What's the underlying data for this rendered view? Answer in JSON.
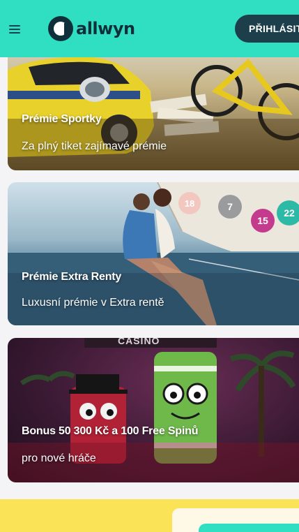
{
  "header": {
    "logo_text": "allwyn",
    "login_label": "PŘIHLÁSIT"
  },
  "icons": [
    "hamburger-menu-icon",
    "allwyn-logo-icon"
  ],
  "colors": {
    "header_bg": "#30dfc1",
    "login_btn": "#1c3f4b",
    "promo_bar": "#fbe357"
  },
  "promos": [
    {
      "title": "Prémie Sportky",
      "subtitle": "Za plný tiket zajímavé prémie"
    },
    {
      "title": "Prémie Extra Renty",
      "subtitle": "Luxusní prémie v Extra rentě"
    },
    {
      "title": "Bonus 50 300 Kč a 100 Free Spinů",
      "subtitle": "pro nové hráče",
      "image_text": "CASINO"
    }
  ],
  "lottery_balls": [
    "18",
    "7",
    "15",
    "22"
  ]
}
